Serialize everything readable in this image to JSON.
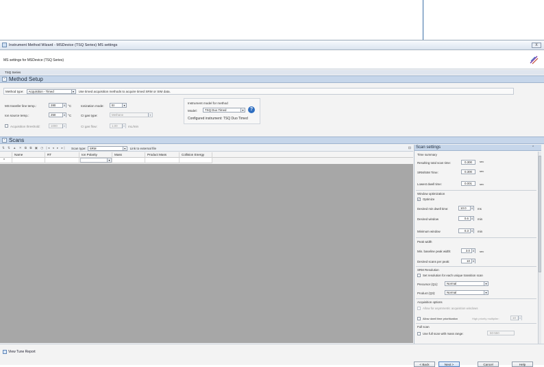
{
  "window": {
    "title": "Instrument Method Wizard - MSDevice (TSQ Series) MS settings",
    "subtitle": "MS settings for MSDevice (TSQ Series)",
    "close_label": "X",
    "series_label": "TSQ Series"
  },
  "method_setup": {
    "header": "Method Setup",
    "method_type_label": "Method type:",
    "method_type_value": "Acquisition - Timed",
    "method_type_desc": "Use timed acquisition methods to acquire timed SRM or SIM data.",
    "ms_transfer_label": "MS transfer line temp.:",
    "ms_transfer_value": "280",
    "ion_source_label": "Ion source temp.:",
    "ion_source_value": "250",
    "unit_c": "°C",
    "acq_threshold_label": "Acquisition threshold:",
    "acq_threshold_value": "1000",
    "ionization_label": "Ionization mode:",
    "ionization_value": "EI",
    "ci_gas_type_label": "CI gas type:",
    "ci_gas_type_value": "Methane",
    "ci_gas_flow_label": "CI gas flow:",
    "ci_gas_flow_value": "1.00",
    "ci_gas_flow_unit": "mL/min",
    "instrument_model_label": "Instrument model for method",
    "model_label": "Model:",
    "model_value": "TSQ Duo Timed",
    "configured_label": "Configured instrument: TSQ Duo Timed"
  },
  "scans": {
    "header": "Scans",
    "scan_type_label": "Scan type:",
    "scan_type_value": "SRM",
    "link_label": "Link to external file",
    "columns": [
      "Name",
      "RT",
      "Ion Polarity",
      "Mass",
      "Product Mass",
      "Collision Energy"
    ],
    "new_row_marker": "*"
  },
  "scan_settings": {
    "header": "Scan settings",
    "time_summary": "Time summary",
    "resulting_label": "Resulting total scan time:",
    "resulting_value": "0.300",
    "srm_sim_label": "SRM/SIM Time:",
    "srm_sim_value": "0.300",
    "lowest_label": "Lowest dwell time:",
    "lowest_value": "0.001",
    "sec": "sec",
    "window_opt": "Window optimization",
    "optimize_label": "Optimize",
    "desired_min_dwell_label": "Desired min dwell time:",
    "desired_min_dwell_value": "10.0",
    "ms": "ms",
    "desired_window_label": "Desired window",
    "desired_window_value": "0.6",
    "min": "min",
    "minimum_window_label": "Minimum window",
    "minimum_window_value": "0.3",
    "peak_width": "Peak width",
    "min_baseline_label": "Min. baseline peak width:",
    "min_baseline_value": "3.0",
    "desired_scans_label": "Desired scans per peak:",
    "desired_scans_value": "10",
    "srm_resolution": "SRM Resolution",
    "set_resolution_label": "Set resolution for each unique transition scan",
    "precursor_label": "Precursor (Q1):",
    "precursor_value": "Normal",
    "product_label": "Product (Q3):",
    "product_value": "Normal",
    "acq_options": "Acquisition options",
    "allow_asym_label": "Allow for asymmetric acquisition windows",
    "allow_dwell_label": "Allow dwell time prioritization",
    "high_priority_label": "High priority multiplier:",
    "high_priority_value": "10",
    "full_scan": "Full scan",
    "use_full_scan_label": "Use full scan with mass range:",
    "mass_range_value": "50-550"
  },
  "footer": {
    "tune_report": "View Tune Report",
    "back": "< Back",
    "next": "Next >",
    "cancel": "Cancel",
    "help": "Help"
  },
  "colors": {
    "section_header": "#c6d6ea",
    "grid_background": "#a7a7a7",
    "accent": "#2f6fc1"
  }
}
